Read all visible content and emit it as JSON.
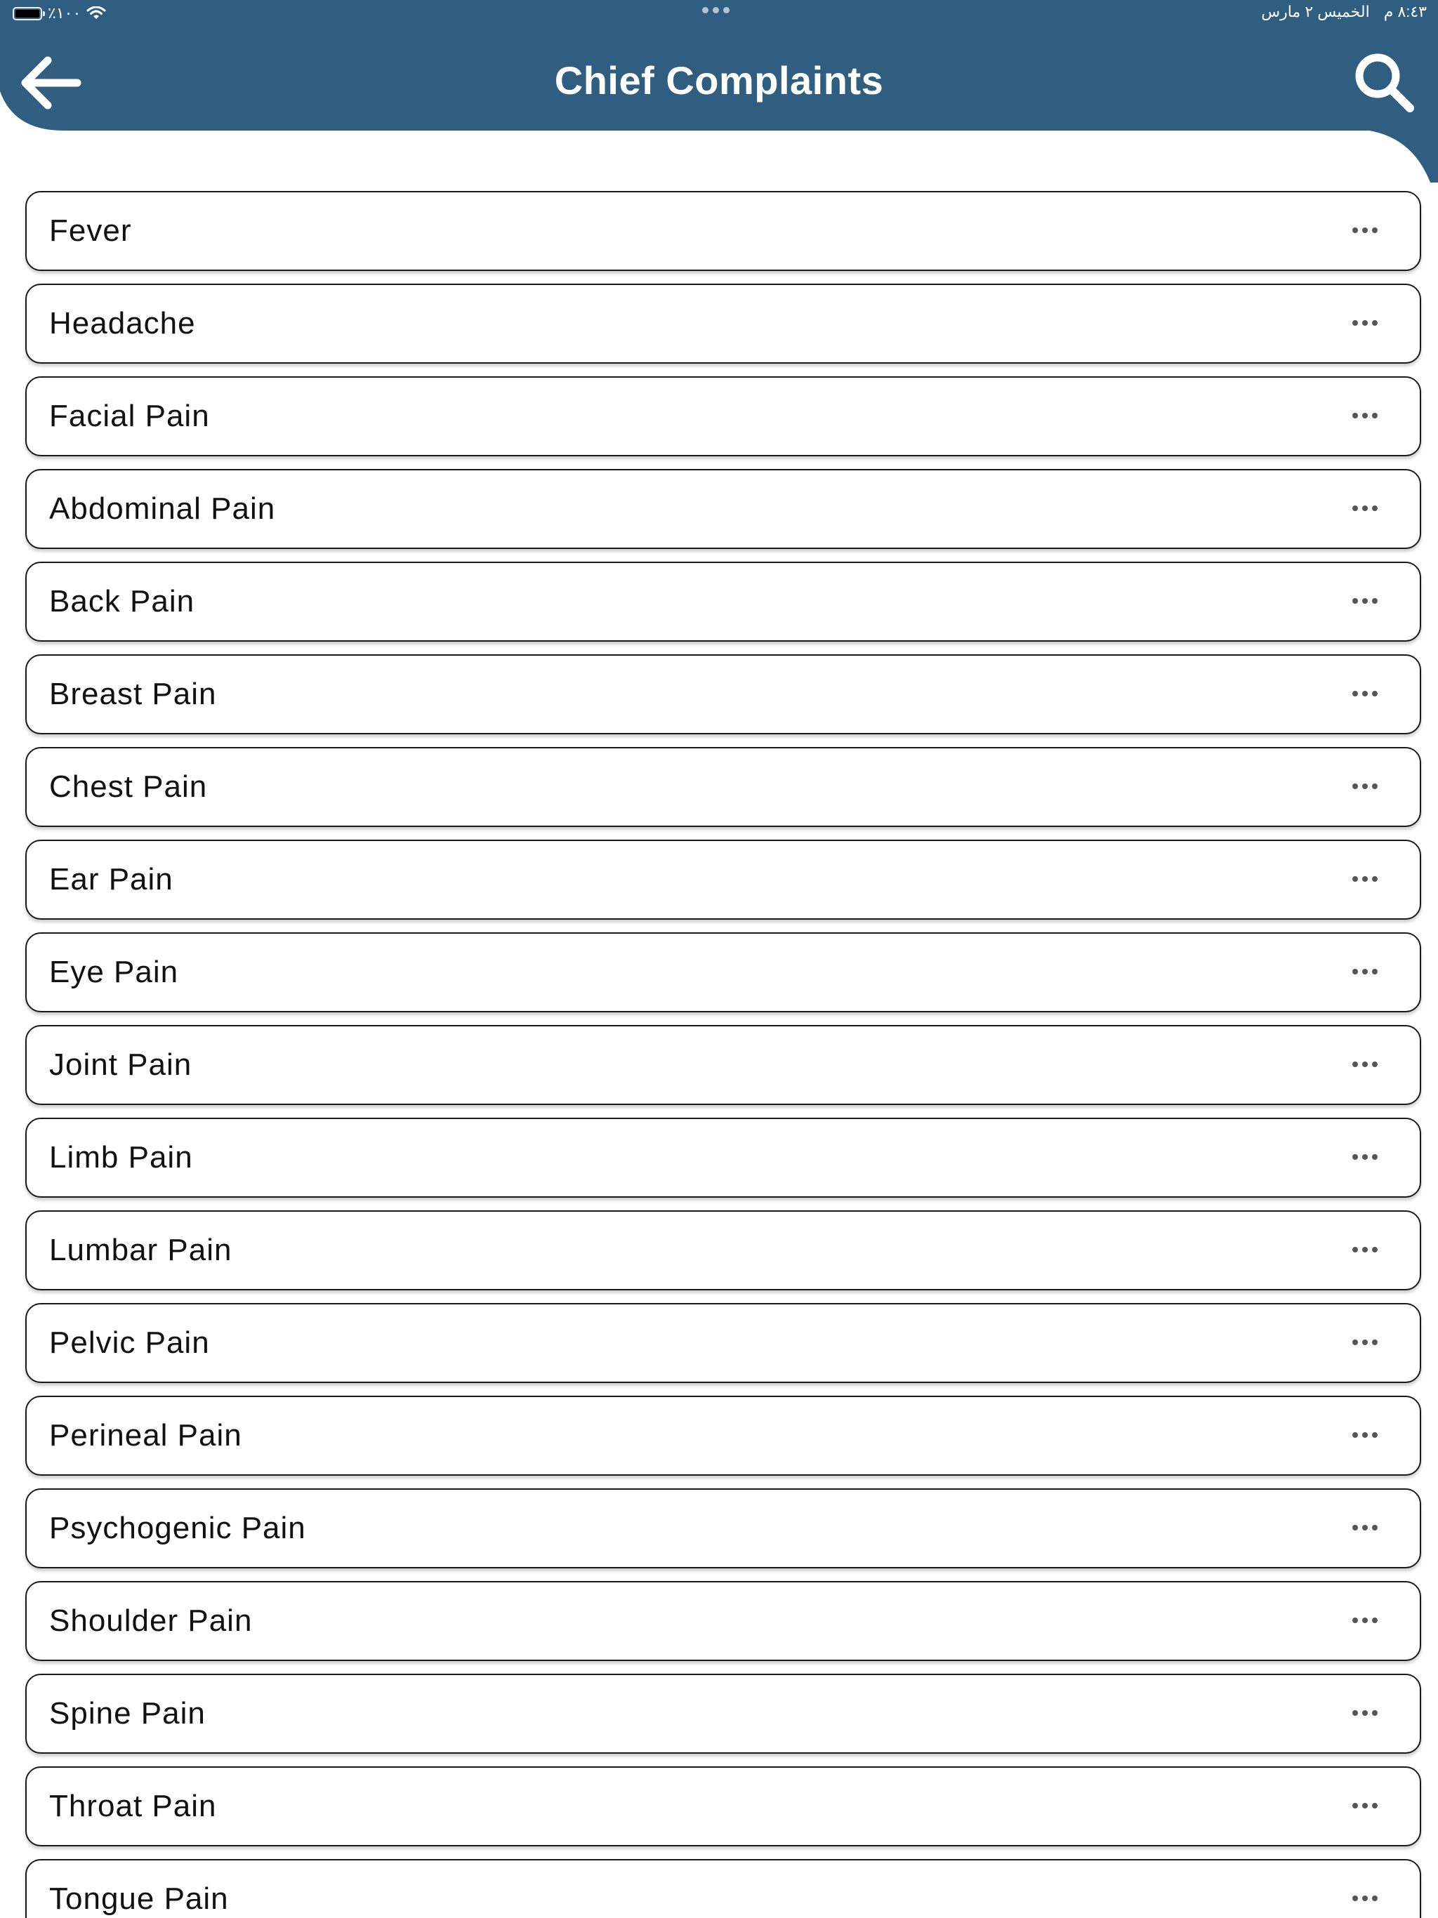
{
  "status_bar": {
    "battery": "٪١٠٠",
    "time": "٨:٤٣ م",
    "date": "الخميس ٢ مارس"
  },
  "header": {
    "title": "Chief Complaints",
    "back_icon": "arrow-left-icon",
    "search_icon": "search-icon",
    "background_color": "#305E80"
  },
  "complaints": [
    "Fever",
    "Headache",
    "Facial Pain",
    "Abdominal Pain",
    "Back Pain",
    "Breast Pain",
    "Chest Pain",
    "Ear Pain",
    "Eye Pain",
    "Joint Pain",
    "Limb Pain",
    "Lumbar Pain",
    "Pelvic Pain",
    "Perineal Pain",
    "Psychogenic Pain",
    "Shoulder Pain",
    "Spine Pain",
    "Throat Pain",
    "Tongue Pain"
  ],
  "item_icon": "more-horizontal-icon"
}
